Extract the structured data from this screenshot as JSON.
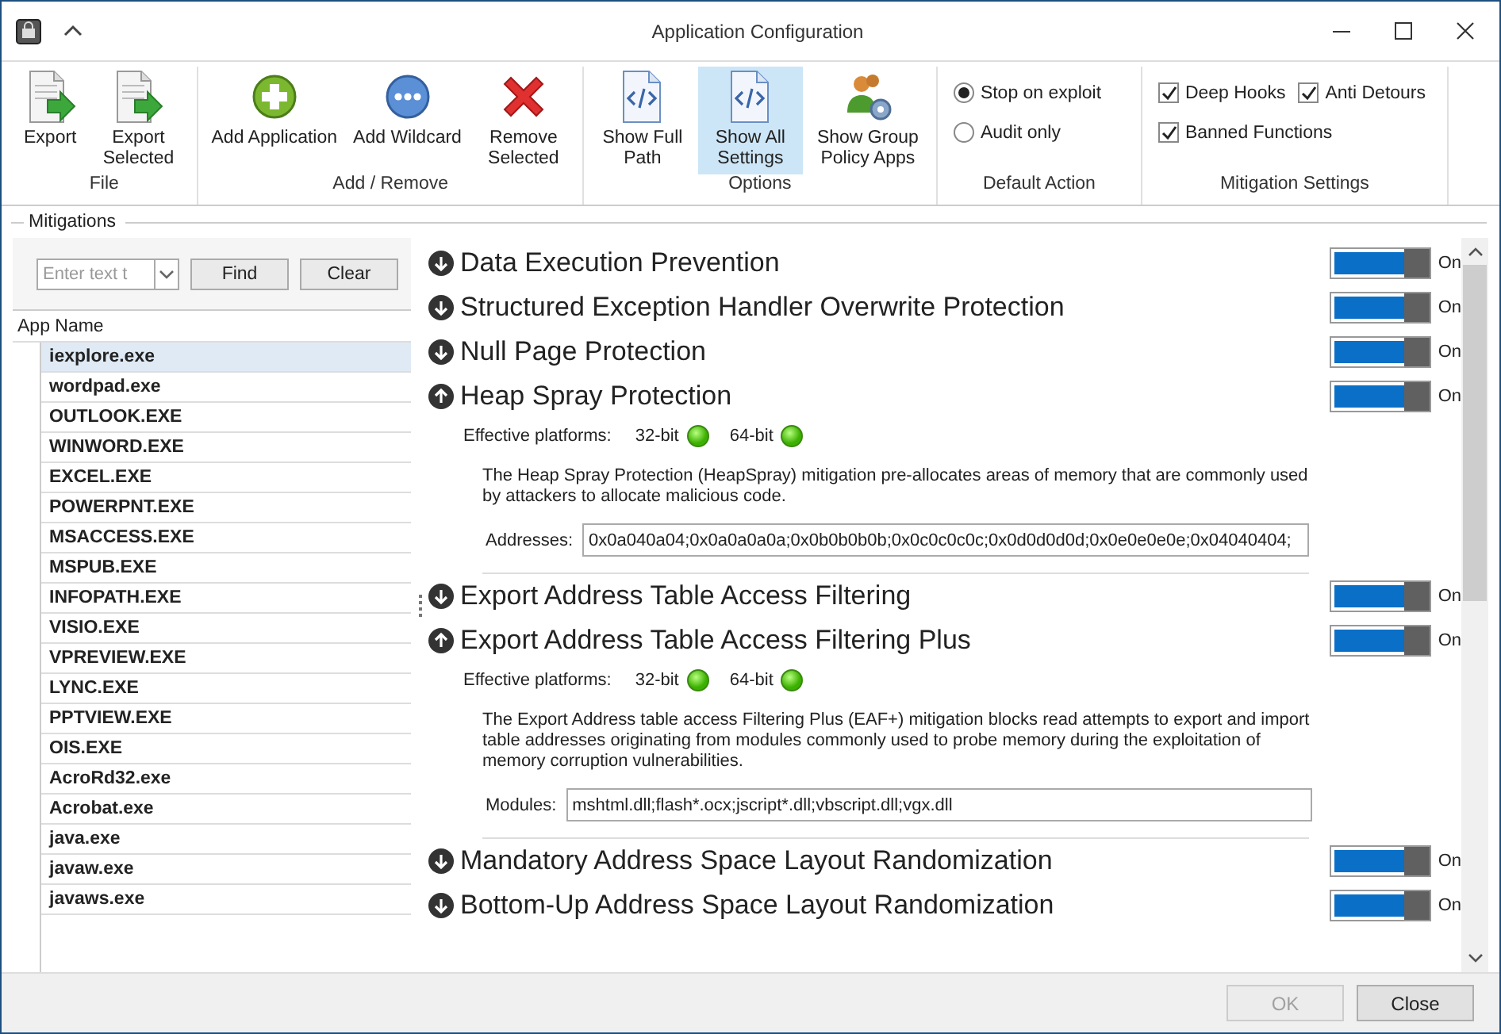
{
  "window": {
    "title": "Application Configuration"
  },
  "ribbon": {
    "groups": [
      {
        "label": "File",
        "buttons": [
          {
            "label": "Export",
            "selected": false
          },
          {
            "label": "Export Selected",
            "selected": false
          }
        ]
      },
      {
        "label": "Add / Remove",
        "buttons": [
          {
            "label": "Add Application",
            "selected": false
          },
          {
            "label": "Add Wildcard",
            "selected": false
          },
          {
            "label": "Remove Selected",
            "selected": false
          }
        ]
      },
      {
        "label": "Options",
        "buttons": [
          {
            "label": "Show Full Path",
            "selected": false
          },
          {
            "label": "Show All Settings",
            "selected": true
          },
          {
            "label": "Show Group Policy Apps",
            "selected": false
          }
        ]
      }
    ],
    "default_action": {
      "label": "Default Action",
      "options": [
        {
          "label": "Stop on exploit",
          "selected": true
        },
        {
          "label": "Audit only",
          "selected": false
        }
      ]
    },
    "mitigation_settings": {
      "label": "Mitigation Settings",
      "options": [
        {
          "label": "Deep Hooks",
          "checked": true
        },
        {
          "label": "Anti Detours",
          "checked": true
        },
        {
          "label": "Banned Functions",
          "checked": true
        }
      ]
    }
  },
  "mitigations_label": "Mitigations",
  "app_list": {
    "search": {
      "placeholder": "Enter text t"
    },
    "buttons": [
      "Find",
      "Clear"
    ],
    "column": "App Name",
    "rows": [
      {
        "name": "iexplore.exe",
        "selected": true
      },
      {
        "name": "wordpad.exe",
        "selected": false
      },
      {
        "name": "OUTLOOK.EXE",
        "selected": false
      },
      {
        "name": "WINWORD.EXE",
        "selected": false
      },
      {
        "name": "EXCEL.EXE",
        "selected": false
      },
      {
        "name": "POWERPNT.EXE",
        "selected": false
      },
      {
        "name": "MSACCESS.EXE",
        "selected": false
      },
      {
        "name": "MSPUB.EXE",
        "selected": false
      },
      {
        "name": "INFOPATH.EXE",
        "selected": false
      },
      {
        "name": "VISIO.EXE",
        "selected": false
      },
      {
        "name": "VPREVIEW.EXE",
        "selected": false
      },
      {
        "name": "LYNC.EXE",
        "selected": false
      },
      {
        "name": "PPTVIEW.EXE",
        "selected": false
      },
      {
        "name": "OIS.EXE",
        "selected": false
      },
      {
        "name": "AcroRd32.exe",
        "selected": false
      },
      {
        "name": "Acrobat.exe",
        "selected": false
      },
      {
        "name": "java.exe",
        "selected": false
      },
      {
        "name": "javaw.exe",
        "selected": false
      },
      {
        "name": "javaws.exe",
        "selected": false
      }
    ]
  },
  "mitigations": [
    {
      "title": "Data Execution Prevention",
      "expanded": false,
      "on": true,
      "state_label": "On"
    },
    {
      "title": "Structured Exception Handler Overwrite Protection",
      "expanded": false,
      "on": true,
      "state_label": "On"
    },
    {
      "title": "Null Page Protection",
      "expanded": false,
      "on": true,
      "state_label": "On"
    },
    {
      "title": "Heap Spray Protection",
      "expanded": true,
      "on": true,
      "state_label": "On",
      "platforms_label": "Effective platforms:",
      "platforms": [
        "32-bit",
        "64-bit"
      ],
      "description": "The Heap Spray Protection (HeapSpray) mitigation pre-allocates areas of memory that are commonly used by attackers to allocate malicious code.",
      "field": {
        "label": "Addresses:",
        "value": "0x0a040a04;0x0a0a0a0a;0x0b0b0b0b;0x0c0c0c0c;0x0d0d0d0d;0x0e0e0e0e;0x04040404;"
      }
    },
    {
      "title": "Export Address Table Access Filtering",
      "expanded": false,
      "on": true,
      "state_label": "On"
    },
    {
      "title": "Export Address Table Access Filtering Plus",
      "expanded": true,
      "on": true,
      "state_label": "On",
      "platforms_label": "Effective platforms:",
      "platforms": [
        "32-bit",
        "64-bit"
      ],
      "description": "The Export Address table access Filtering Plus (EAF+) mitigation blocks read attempts to export and import table addresses originating from modules commonly used to probe memory during the exploitation of memory corruption vulnerabilities.",
      "field": {
        "label": "Modules:",
        "value": "mshtml.dll;flash*.ocx;jscript*.dll;vbscript.dll;vgx.dll"
      }
    },
    {
      "title": "Mandatory Address Space Layout Randomization",
      "expanded": false,
      "on": true,
      "state_label": "On"
    },
    {
      "title": "Bottom-Up Address Space Layout Randomization",
      "expanded": false,
      "on": true,
      "state_label": "On"
    }
  ],
  "footer": {
    "buttons": [
      {
        "label": "OK",
        "disabled": true
      },
      {
        "label": "Close",
        "disabled": false
      }
    ]
  }
}
